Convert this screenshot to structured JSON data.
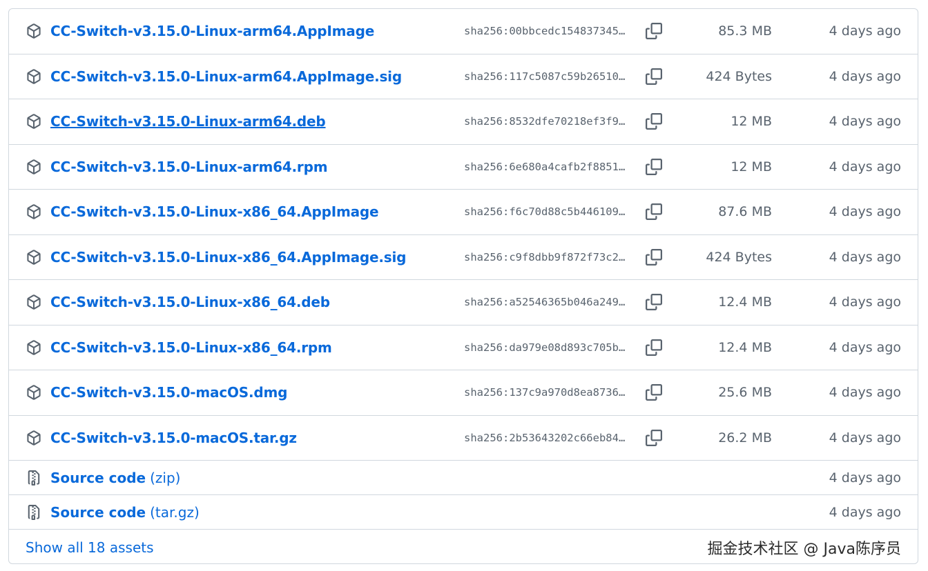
{
  "assets": [
    {
      "name": "CC-Switch-v3.15.0-Linux-arm64.AppImage",
      "sha": "sha256:00bbcedc154837345…",
      "size": "85.3 MB",
      "date": "4 days ago",
      "underlined": false
    },
    {
      "name": "CC-Switch-v3.15.0-Linux-arm64.AppImage.sig",
      "sha": "sha256:117c5087c59b26510…",
      "size": "424 Bytes",
      "date": "4 days ago",
      "underlined": false
    },
    {
      "name": "CC-Switch-v3.15.0-Linux-arm64.deb",
      "sha": "sha256:8532dfe70218ef3f9…",
      "size": "12 MB",
      "date": "4 days ago",
      "underlined": true
    },
    {
      "name": "CC-Switch-v3.15.0-Linux-arm64.rpm",
      "sha": "sha256:6e680a4cafb2f8851…",
      "size": "12 MB",
      "date": "4 days ago",
      "underlined": false
    },
    {
      "name": "CC-Switch-v3.15.0-Linux-x86_64.AppImage",
      "sha": "sha256:f6c70d88c5b446109…",
      "size": "87.6 MB",
      "date": "4 days ago",
      "underlined": false
    },
    {
      "name": "CC-Switch-v3.15.0-Linux-x86_64.AppImage.sig",
      "sha": "sha256:c9f8dbb9f872f73c2…",
      "size": "424 Bytes",
      "date": "4 days ago",
      "underlined": false
    },
    {
      "name": "CC-Switch-v3.15.0-Linux-x86_64.deb",
      "sha": "sha256:a52546365b046a249…",
      "size": "12.4 MB",
      "date": "4 days ago",
      "underlined": false
    },
    {
      "name": "CC-Switch-v3.15.0-Linux-x86_64.rpm",
      "sha": "sha256:da979e08d893c705b…",
      "size": "12.4 MB",
      "date": "4 days ago",
      "underlined": false
    },
    {
      "name": "CC-Switch-v3.15.0-macOS.dmg",
      "sha": "sha256:137c9a970d8ea8736…",
      "size": "25.6 MB",
      "date": "4 days ago",
      "underlined": false
    },
    {
      "name": "CC-Switch-v3.15.0-macOS.tar.gz",
      "sha": "sha256:2b53643202c66eb84…",
      "size": "26.2 MB",
      "date": "4 days ago",
      "underlined": false
    }
  ],
  "source_code": [
    {
      "label": "Source code",
      "ext": "(zip)",
      "date": "4 days ago"
    },
    {
      "label": "Source code",
      "ext": "(tar.gz)",
      "date": "4 days ago"
    }
  ],
  "footer": {
    "show_all_label": "Show all 18 assets",
    "watermark": "掘金技术社区 @ Java陈序员"
  },
  "icons": {
    "asset": "package-icon",
    "source": "file-zip-icon",
    "copy": "copy-icon"
  },
  "colors": {
    "link": "#0969da",
    "muted": "#59636e",
    "border": "#d0d7de"
  }
}
